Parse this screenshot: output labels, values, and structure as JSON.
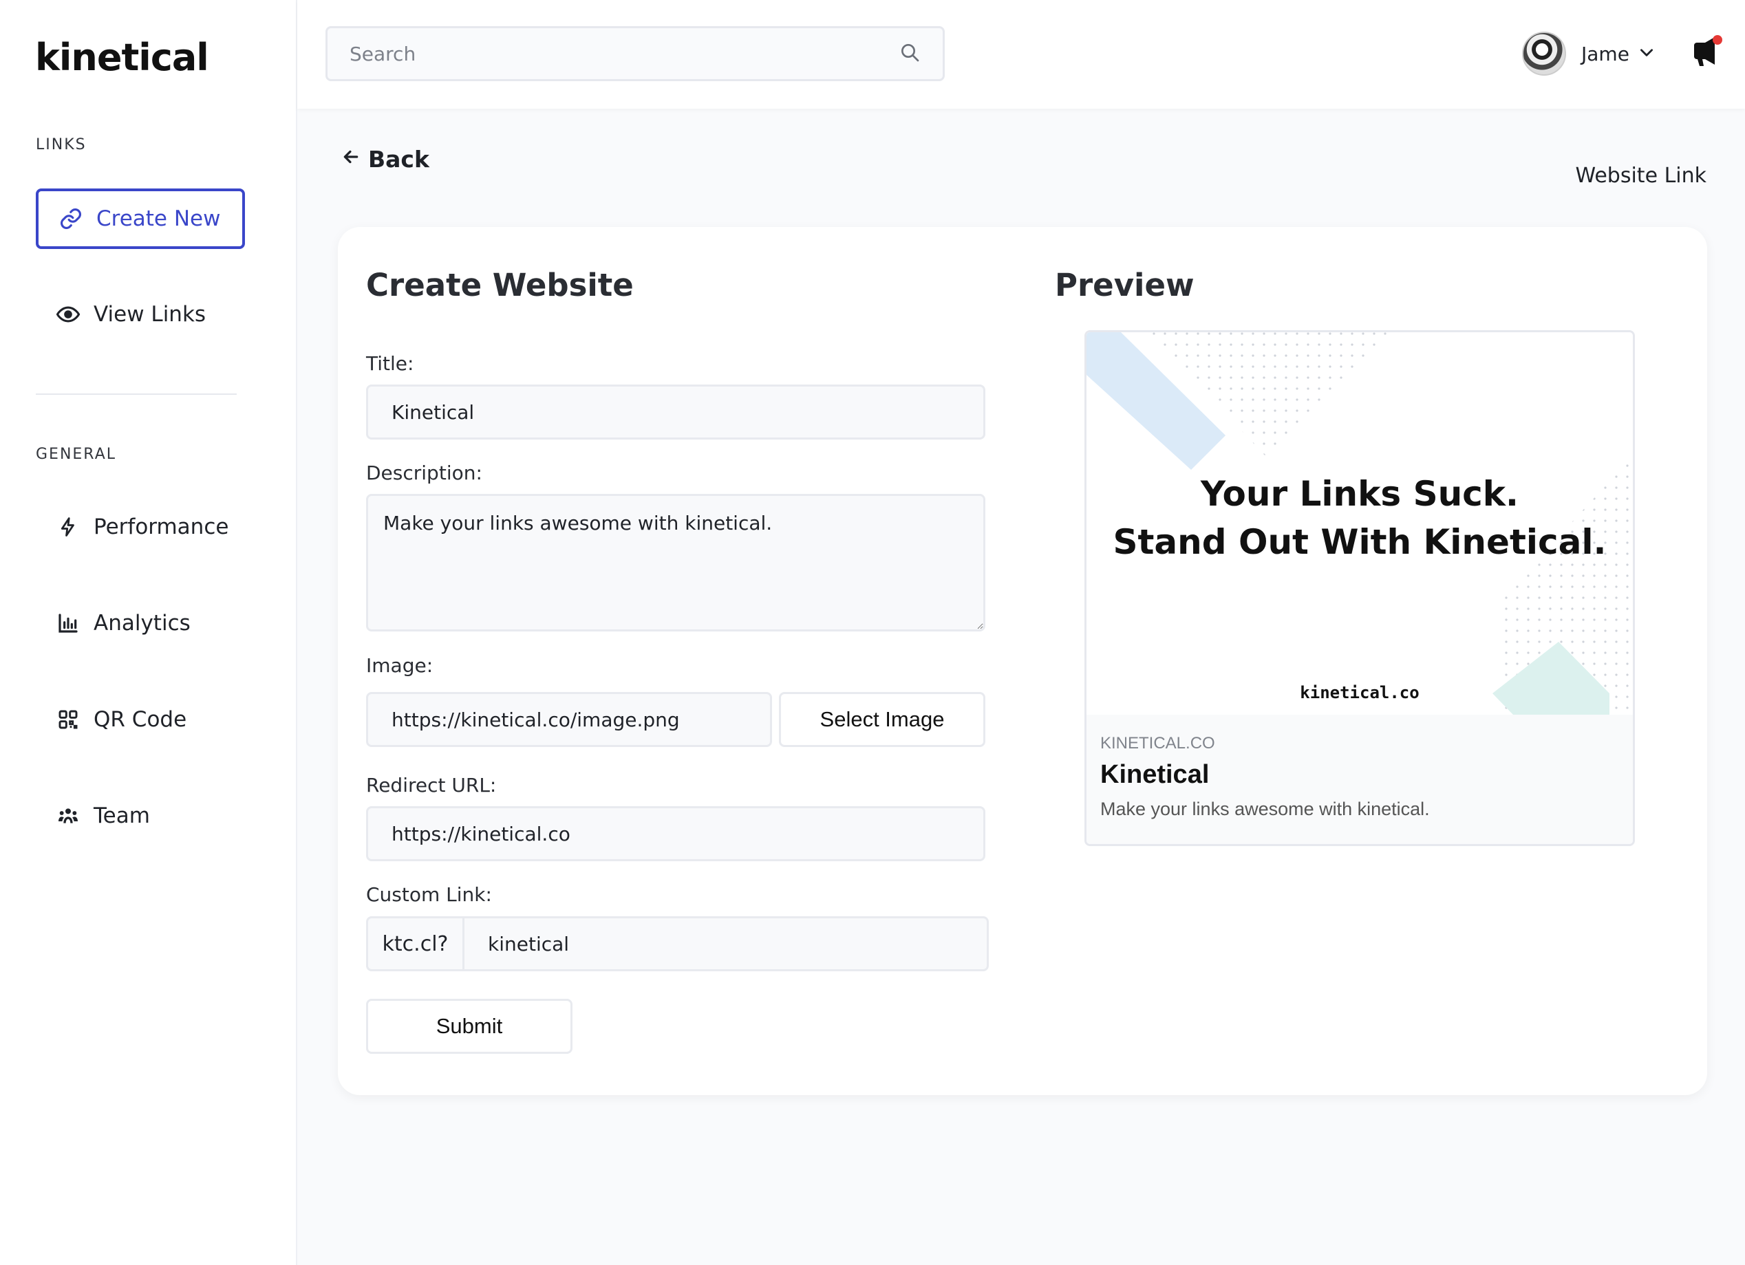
{
  "brand": {
    "logo": "kinetical",
    "accent": "#3a46c9"
  },
  "sidebar": {
    "section_links": "LINKS",
    "create_new": "Create New",
    "view_links": "View Links",
    "section_general": "GENERAL",
    "items": [
      {
        "label": "Performance",
        "icon": "bolt-icon"
      },
      {
        "label": "Analytics",
        "icon": "bar-chart-icon"
      },
      {
        "label": "QR Code",
        "icon": "qr-code-icon"
      },
      {
        "label": "Team",
        "icon": "team-icon"
      }
    ]
  },
  "header": {
    "search_placeholder": "Search",
    "user_name": "Jame"
  },
  "page": {
    "back_label": "Back",
    "link_type": "Website Link"
  },
  "form": {
    "heading": "Create Website",
    "title_label": "Title:",
    "title_value": "Kinetical",
    "description_label": "Description:",
    "description_value": "Make your links awesome with kinetical.",
    "image_label": "Image:",
    "image_value": "https://kinetical.co/image.png",
    "select_image": "Select Image",
    "redirect_label": "Redirect URL:",
    "redirect_value": "https://kinetical.co",
    "custom_label": "Custom Link:",
    "custom_prefix": "ktc.cl?",
    "custom_value": "kinetical",
    "submit": "Submit"
  },
  "preview": {
    "heading": "Preview",
    "headline_line1": "Your Links Suck.",
    "headline_line2": "Stand Out With Kinetical.",
    "image_url_text": "kinetical.co",
    "domain": "KINETICAL.CO",
    "title": "Kinetical",
    "description": "Make your links awesome with kinetical."
  }
}
